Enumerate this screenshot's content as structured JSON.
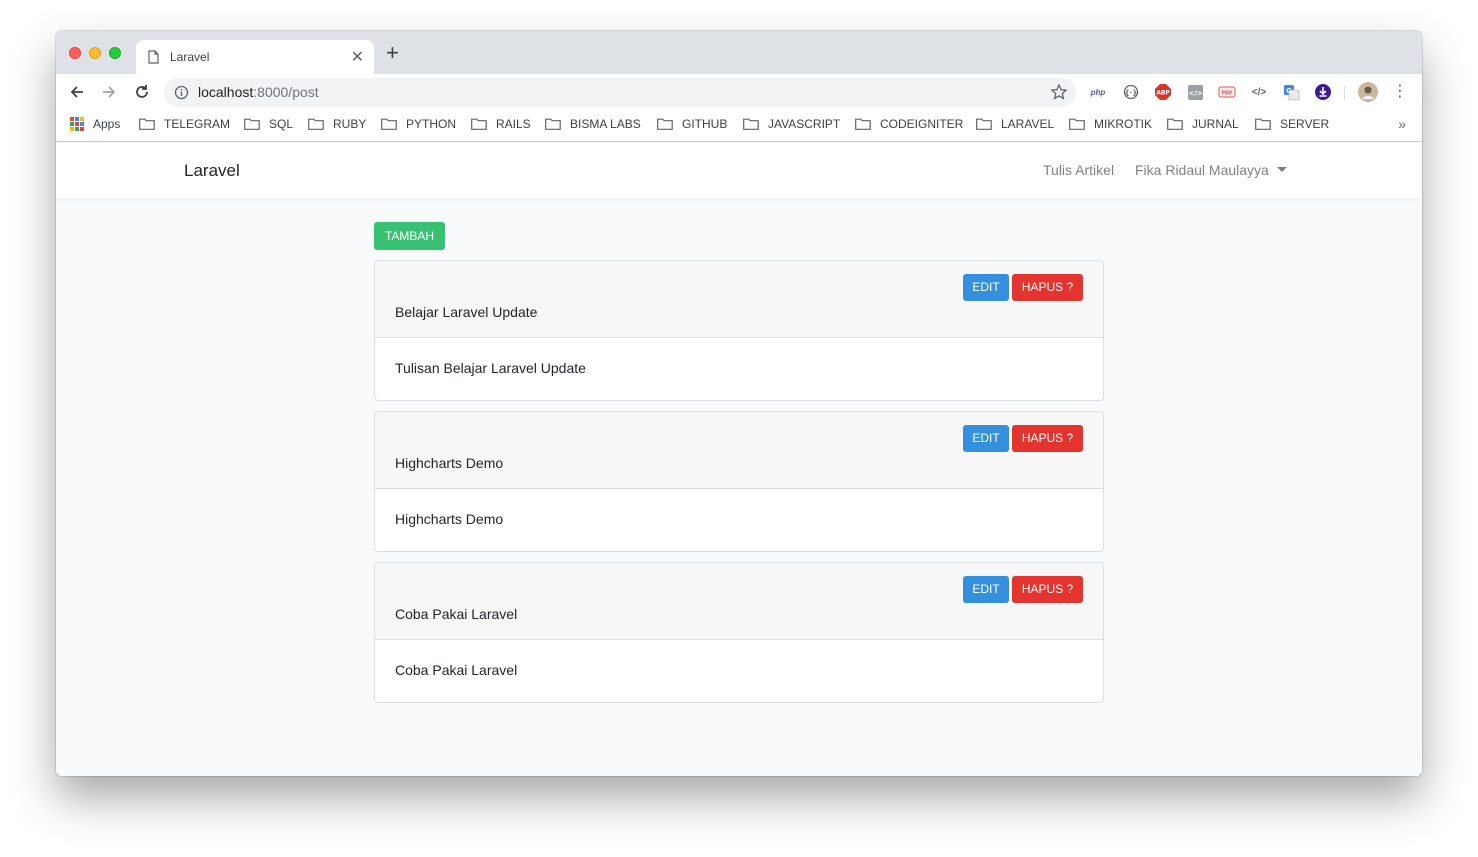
{
  "browser": {
    "tab_title": "Laravel",
    "url_host": "localhost",
    "url_rest": ":8000/post",
    "bookmarks": [
      "Apps",
      "TELEGRAM",
      "SQL",
      "RUBY",
      "PYTHON",
      "RAILS",
      "BISMA LABS",
      "GITHUB",
      "JAVASCRIPT",
      "CODEIGNITER",
      "LARAVEL",
      "MIKROTIK",
      "JURNAL",
      "SERVER"
    ],
    "bookmarks_overflow": "»"
  },
  "navbar": {
    "brand": "Laravel",
    "write_link": "Tulis Artikel",
    "user_name": "Fika Ridaul Maulayya"
  },
  "actions": {
    "add_label": "TAMBAH",
    "edit_label": "EDIT",
    "delete_label": "HAPUS ?"
  },
  "posts": [
    {
      "title": "Belajar Laravel Update",
      "body": "Tulisan Belajar Laravel Update"
    },
    {
      "title": "Highcharts Demo",
      "body": "Highcharts Demo"
    },
    {
      "title": "Coba Pakai Laravel",
      "body": "Coba Pakai Laravel"
    }
  ],
  "colors": {
    "success": "#38c172",
    "primary": "#3490dc",
    "danger": "#e3342f"
  }
}
